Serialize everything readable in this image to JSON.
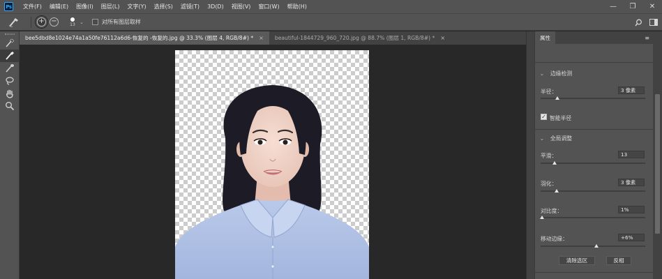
{
  "app": {
    "logo_text": "Ps"
  },
  "menu": [
    "文件(F)",
    "编辑(E)",
    "图像(I)",
    "图层(L)",
    "文字(Y)",
    "选择(S)",
    "滤镜(T)",
    "3D(D)",
    "视图(V)",
    "窗口(W)",
    "帮助(H)"
  ],
  "window_controls": {
    "minimize": "—",
    "restore": "❐",
    "close": "✕"
  },
  "options_bar": {
    "brush_size": "13",
    "sample_all_layers_label": "对所有图层取样",
    "sample_all_layers_checked": false
  },
  "tabs": [
    {
      "label": "bee5dbd8e1024e74a1a50fe76112a6d6-恢复的 -恢复的.jpg @ 33.3% (图层 4, RGB/8#) *",
      "active": true,
      "close": "×"
    },
    {
      "label": "beautiful-1844729_960_720.jpg @ 88.7% (图层 1, RGB/8#) *",
      "active": false,
      "close": "×"
    }
  ],
  "panel": {
    "tab_label": "属性",
    "edge_detection": {
      "title": "边缘检测",
      "radius_label": "半径：",
      "radius_value": "3 像素",
      "radius_slider": 0.16,
      "smart_radius_label": "智能半径",
      "smart_radius_checked": true
    },
    "global_refine": {
      "title": "全局调整",
      "smooth_label": "平滑：",
      "smooth_value": "13",
      "smooth_slider": 0.13,
      "feather_label": "羽化：",
      "feather_value": "3 像素",
      "feather_slider": 0.15,
      "contrast_label": "对比度：",
      "contrast_value": "1%",
      "contrast_slider": 0.01,
      "shift_edge_label": "移动边缘：",
      "shift_edge_value": "+6%",
      "shift_edge_slider": 0.53
    },
    "clear_selection_label": "清除选区",
    "invert_label": "反相"
  }
}
